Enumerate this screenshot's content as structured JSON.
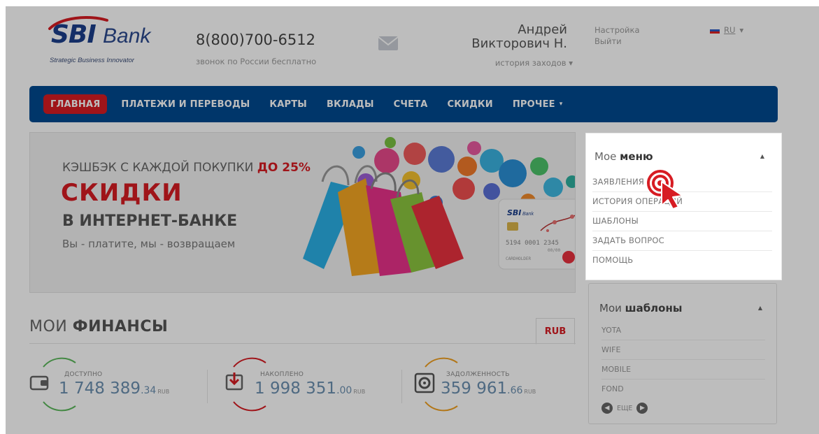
{
  "header": {
    "logo_text": "SBI",
    "logo_bank": "Bank",
    "logo_tagline": "Strategic Business Innovator",
    "phone": "8(800)700-6512",
    "phone_note": "звонок по России бесплатно",
    "user_first": "Андрей",
    "user_second": "Викторович Н.",
    "history_label": "история заходов",
    "settings_label": "Настройка",
    "logout_label": "Выйти",
    "language": "RU"
  },
  "nav": {
    "items": [
      {
        "label": "ГЛАВНАЯ"
      },
      {
        "label": "ПЛАТЕЖИ И ПЕРЕВОДЫ"
      },
      {
        "label": "КАРТЫ"
      },
      {
        "label": "ВКЛАДЫ"
      },
      {
        "label": "СЧЕТА"
      },
      {
        "label": "СКИДКИ"
      },
      {
        "label": "ПРОЧЕЕ"
      }
    ]
  },
  "banner": {
    "line1": "КЭШБЭК С КАЖДОЙ ПОКУПКИ",
    "line1_highlight": "ДО 25%",
    "title": "СКИДКИ",
    "subtitle": "В ИНТЕРНЕТ-БАНКЕ",
    "slogan": "Вы - платите, мы - возвращаем",
    "card_bank": "SBI",
    "card_bank_word": "Bank",
    "card_number": "5194 0001 2345",
    "card_expiry": "00/00",
    "card_holder": "CARDHOLDER"
  },
  "finances": {
    "title_light": "МОИ",
    "title_bold": "ФИНАНСЫ",
    "currency_tab": "RUB",
    "stats": [
      {
        "label": "ДОСТУПНО",
        "main": "1 748 389",
        "cents": ".34",
        "currency": "RUB",
        "color": "#5bb85b"
      },
      {
        "label": "НАКОПЛЕНО",
        "main": "1 998 351",
        "cents": ".00",
        "currency": "RUB",
        "color": "#d71c23"
      },
      {
        "label": "ЗАДОЛЖЕННОСТЬ",
        "main": "359 961",
        "cents": ".66",
        "currency": "RUB",
        "color": "#f0a020"
      }
    ]
  },
  "my_menu": {
    "title_light": "Мое",
    "title_bold": "меню",
    "items": [
      {
        "label": "ЗАЯВЛЕНИЯ"
      },
      {
        "label": "ИСТОРИЯ ОПЕРАЦИЙ"
      },
      {
        "label": "ШАБЛОНЫ"
      },
      {
        "label": "ЗАДАТЬ ВОПРОС"
      },
      {
        "label": "ПОМОЩЬ"
      }
    ]
  },
  "my_templates": {
    "title_light": "Мои",
    "title_bold": "шаблоны",
    "items": [
      {
        "label": "YOTA"
      },
      {
        "label": "WIFE"
      },
      {
        "label": "MOBILE"
      },
      {
        "label": "FOND"
      }
    ],
    "more_label": "ЕЩЕ"
  },
  "colors": {
    "nav_bg": "#004a8f",
    "accent_red": "#d71c23",
    "overlay": "rgba(0,0,0,0.26)"
  }
}
